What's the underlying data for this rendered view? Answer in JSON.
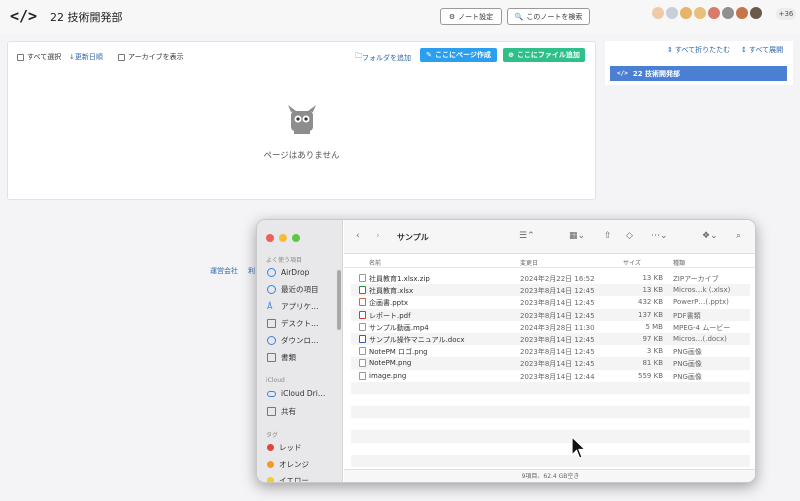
{
  "header": {
    "logo_text": "</>",
    "notebook_title": "22 技術開発部",
    "settings_label": "ノート設定",
    "search_label": "このノートを検索",
    "more_members": "+36"
  },
  "toolbar": {
    "select_all": "すべて選択",
    "sort_label": "更新日順",
    "show_archive": "アーカイブを表示",
    "add_folder": "フォルダを追加",
    "create_page": "ここにページ作成",
    "add_file": "ここにファイル追加"
  },
  "empty_state": {
    "message": "ページはありません"
  },
  "side": {
    "collapse_all": "すべて折りたたむ",
    "expand_all": "すべて展開",
    "tree_item": "22 技術開発部"
  },
  "footer": {
    "link1": "運営会社",
    "link2": "利"
  },
  "finder": {
    "title": "サンプル",
    "sidebar": {
      "favorites_head": "よく使う項目",
      "items": [
        "AirDrop",
        "最近の項目",
        "アプリケ…",
        "デスクト…",
        "ダウンロ…",
        "書類"
      ],
      "icloud_head": "iCloud",
      "icloud_items": [
        "iCloud Dri…",
        "共有"
      ],
      "tags_head": "タグ",
      "tags": [
        {
          "label": "レッド",
          "color": "#e4453a"
        },
        {
          "label": "オレンジ",
          "color": "#f29a28"
        },
        {
          "label": "イエロー",
          "color": "#f3cd2c"
        }
      ]
    },
    "columns": {
      "name": "名前",
      "date": "変更日",
      "size": "サイズ",
      "kind": "種類"
    },
    "files": [
      {
        "name": "社員教育1.xlsx.zip",
        "date": "2024年2月22日 16:52",
        "size": "13 KB",
        "kind": "ZIPアーカイブ"
      },
      {
        "name": "社員教育.xlsx",
        "date": "2023年8月14日 12:45",
        "size": "13 KB",
        "kind": "Micros…k (.xlsx)"
      },
      {
        "name": "企画書.pptx",
        "date": "2023年8月14日 12:45",
        "size": "432 KB",
        "kind": "PowerP…(.pptx)"
      },
      {
        "name": "レポート.pdf",
        "date": "2023年8月14日 12:45",
        "size": "137 KB",
        "kind": "PDF書類"
      },
      {
        "name": "サンプル動画.mp4",
        "date": "2024年3月28日 11:30",
        "size": "5 MB",
        "kind": "MPEG-4 ムービー"
      },
      {
        "name": "サンプル操作マニュアル.docx",
        "date": "2023年8月14日 12:45",
        "size": "97 KB",
        "kind": "Micros…(.docx)"
      },
      {
        "name": "NotePM ロゴ.png",
        "date": "2023年8月14日 12:45",
        "size": "3 KB",
        "kind": "PNG画像"
      },
      {
        "name": "NotePM.png",
        "date": "2023年8月14日 12:45",
        "size": "81 KB",
        "kind": "PNG画像"
      },
      {
        "name": "image.png",
        "date": "2023年8月14日 12:44",
        "size": "559 KB",
        "kind": "PNG画像"
      }
    ],
    "status": "9項目、62.4 GB空き"
  }
}
